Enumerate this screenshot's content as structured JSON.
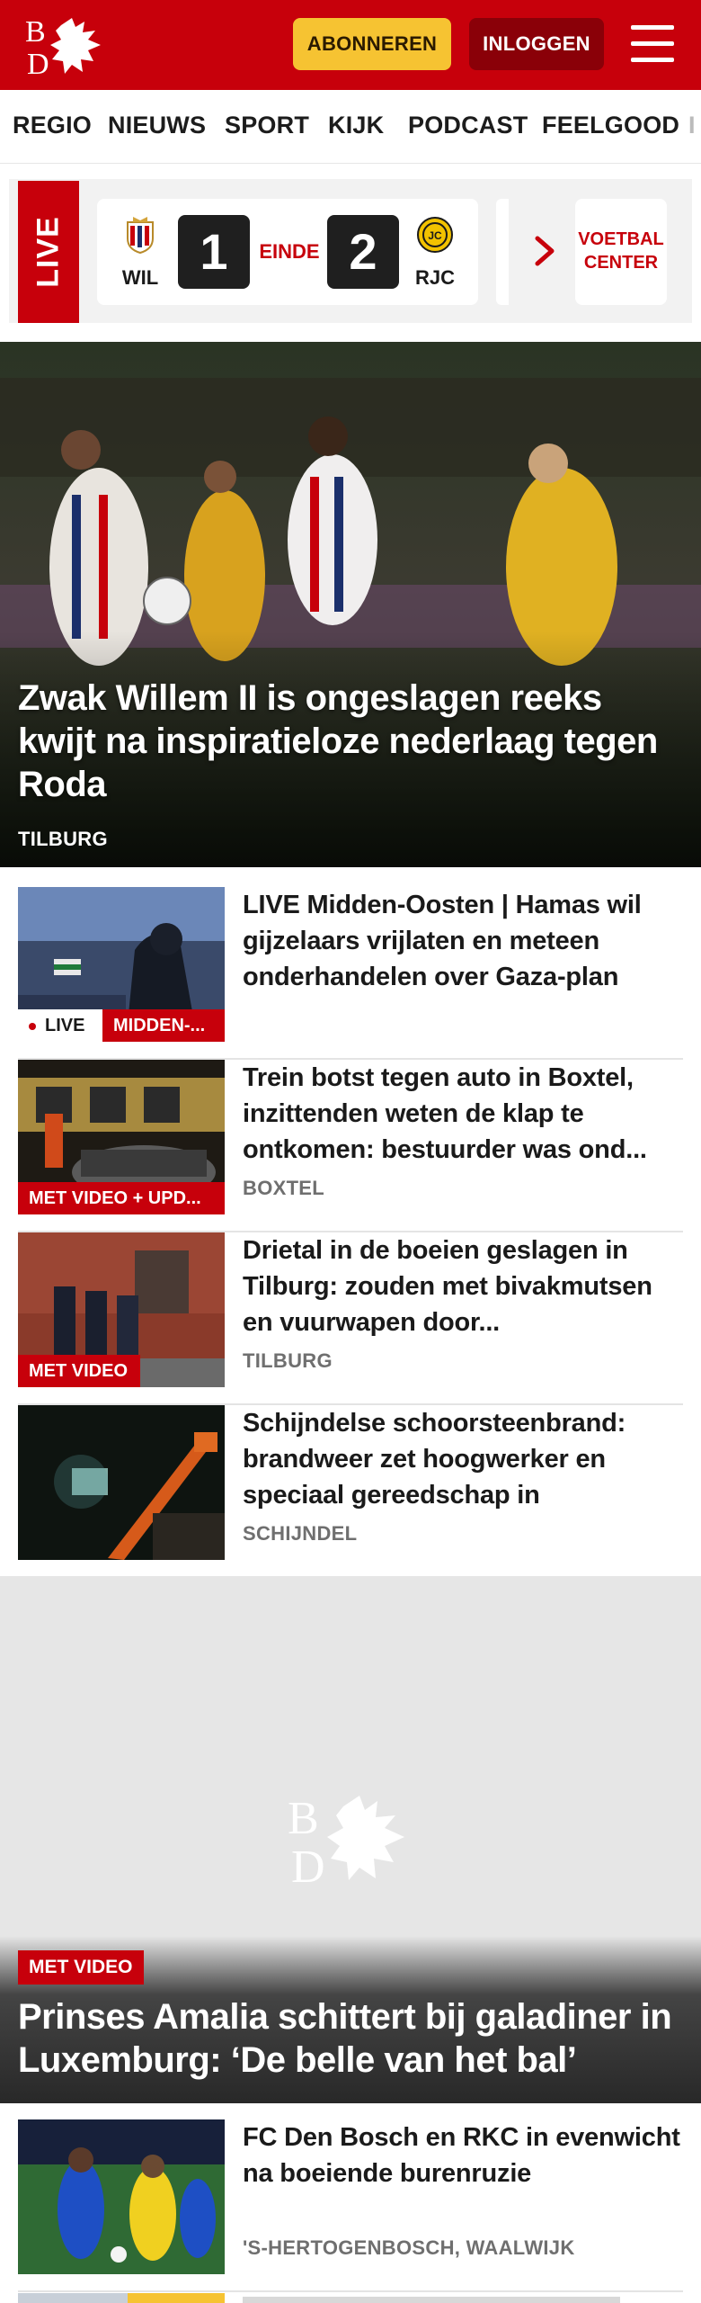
{
  "header": {
    "logo_text": "BD",
    "subscribe_label": "ABONNEREN",
    "login_label": "INLOGGEN",
    "brand_color": "#c7000b",
    "menu_icon": "hamburger-icon"
  },
  "nav": {
    "items": [
      "REGIO",
      "NIEUWS",
      "SPORT",
      "KIJK",
      "PODCAST",
      "FEELGOOD",
      "I"
    ]
  },
  "live_strip": {
    "live_label": "LIVE",
    "match": {
      "home_abbr": "WIL",
      "home_score": "1",
      "status": "EINDE",
      "away_score": "2",
      "away_abbr": "RJC"
    },
    "next_icon": "chevron-right-icon",
    "voetbal_center_label": "VOETBAL CENTER"
  },
  "hero": {
    "title": "Zwak Willem II is ongeslagen reeks kwijt na inspiratieloze nederlaag tegen Roda",
    "location": "TILBURG"
  },
  "articles": [
    {
      "badge_live": "LIVE",
      "badge": "MIDDEN-...",
      "title": "LIVE Midden-Oosten | Hamas wil gijzelaars vrijlaten en meteen onderhandelen over Gaza-plan",
      "location": ""
    },
    {
      "badge": "MET VIDEO + UPD...",
      "title": "Trein botst tegen auto in Boxtel, inzittenden weten de klap te ontkomen: bestuurder was ond...",
      "location": "BOXTEL"
    },
    {
      "badge": "MET VIDEO",
      "title": "Drietal in de boeien geslagen in Tilburg: zouden met bivakmut­sen en vuurwapen door...",
      "location": "TILBURG"
    },
    {
      "badge": "",
      "title": "Schijndelse schoorsteenbrand: brandweer zet hoogwerker en speciaal gereedschap in",
      "location": "SCHIJNDEL"
    }
  ],
  "feature": {
    "badge": "MET VIDEO",
    "title": "Prinses Amalia schittert bij galadiner in Luxemburg: ‘De belle van het bal’"
  },
  "article_bottom": {
    "title": "FC Den Bosch en RKC in evenwicht na boeiende burenruzie",
    "location": "'S-HERTOGENBOSCH, WAALWIJK"
  }
}
